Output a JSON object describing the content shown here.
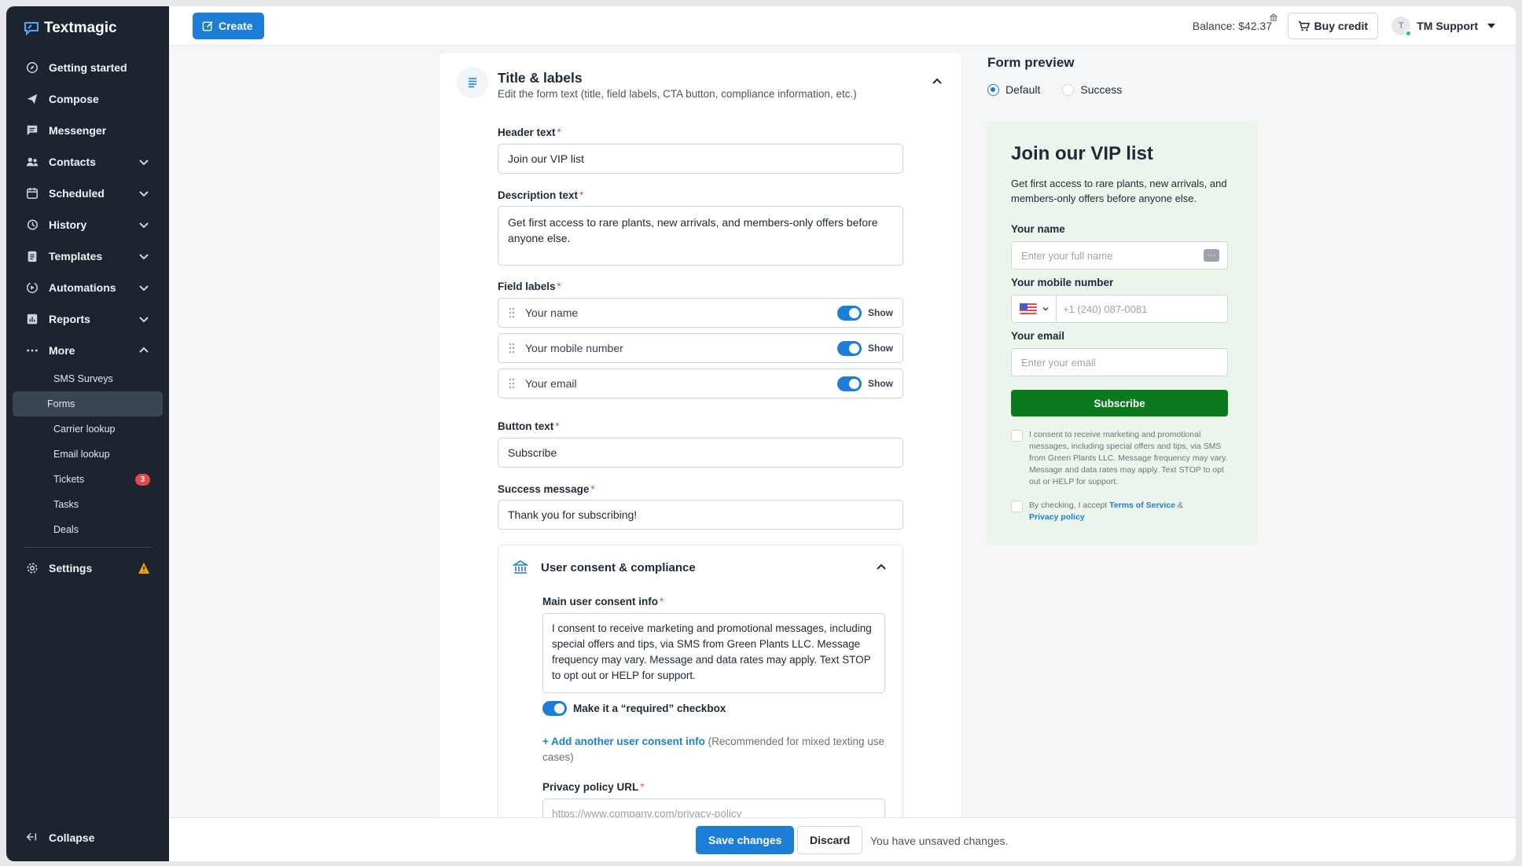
{
  "brand": {
    "name": "Textmagic"
  },
  "sidebar": {
    "items": [
      {
        "label": "Getting started",
        "icon": "compass-icon",
        "expandable": false
      },
      {
        "label": "Compose",
        "icon": "send-icon",
        "expandable": false
      },
      {
        "label": "Messenger",
        "icon": "chat-icon",
        "expandable": false
      },
      {
        "label": "Contacts",
        "icon": "contacts-icon",
        "expandable": true
      },
      {
        "label": "Scheduled",
        "icon": "calendar-icon",
        "expandable": true
      },
      {
        "label": "History",
        "icon": "history-icon",
        "expandable": true
      },
      {
        "label": "Templates",
        "icon": "clipboard-icon",
        "expandable": true
      },
      {
        "label": "Automations",
        "icon": "automation-icon",
        "expandable": true
      },
      {
        "label": "Reports",
        "icon": "chart-icon",
        "expandable": true
      },
      {
        "label": "More",
        "icon": "dots-icon",
        "expandable": true,
        "expanded": true
      }
    ],
    "more_sub": [
      {
        "label": "SMS Surveys"
      },
      {
        "label": "Forms",
        "active": true
      },
      {
        "label": "Carrier lookup"
      },
      {
        "label": "Email lookup"
      },
      {
        "label": "Tickets",
        "badge": "3"
      },
      {
        "label": "Tasks"
      },
      {
        "label": "Deals"
      }
    ],
    "settings_label": "Settings",
    "collapse_label": "Collapse"
  },
  "topbar": {
    "create_label": "Create",
    "balance": "Balance: $42.37",
    "buy_credit_label": "Buy credit",
    "user_initial": "T",
    "user_name": "TM Support"
  },
  "editor": {
    "section_title": "Title & labels",
    "section_desc": "Edit the form text (title, field labels, CTA button, compliance information, etc.)",
    "header_label": "Header text",
    "header_value": "Join our VIP list",
    "description_label": "Description text",
    "description_value": "Get first access to rare plants, new arrivals, and members-only offers before anyone else.",
    "field_labels_label": "Field labels",
    "field_labels": [
      {
        "text": "Your name",
        "show": "Show",
        "enabled": true
      },
      {
        "text": "Your mobile number",
        "show": "Show",
        "enabled": true
      },
      {
        "text": "Your email",
        "show": "Show",
        "enabled": true
      }
    ],
    "button_label": "Button text",
    "button_value": "Subscribe",
    "success_label": "Success message",
    "success_value": "Thank you for subscribing!",
    "consent": {
      "title": "User consent & compliance",
      "main_label": "Main user consent info",
      "main_value": "I consent to receive marketing and promotional messages, including special offers and tips, via SMS from Green Plants LLC. Message frequency may vary. Message and data rates may apply. Text STOP to opt out or HELP for support.",
      "required_label": "Make it a “required” checkbox",
      "add_link": "Add another user consent info",
      "add_note": "(Recommended for mixed texting use cases)",
      "privacy_label": "Privacy policy URL",
      "privacy_placeholder": "https://www.company.com/privacy-policy"
    }
  },
  "preview": {
    "title": "Form preview",
    "modes": [
      {
        "label": "Default",
        "selected": true
      },
      {
        "label": "Success",
        "selected": false
      }
    ],
    "heading": "Join our VIP list",
    "desc": "Get first access to rare plants, new arrivals, and members-only offers before anyone else.",
    "name_label": "Your name",
    "name_placeholder": "Enter your full name",
    "more_glyph": "···",
    "mobile_label": "Your mobile number",
    "mobile_placeholder": "+1 (240) 087-0081",
    "email_label": "Your email",
    "email_placeholder": "Enter your email",
    "button": "Subscribe",
    "consent_text": "I consent to receive marketing and promotional messages, including special offers and tips, via SMS from Green Plants LLC. Message frequency may vary. Message and data rates may apply. Text STOP to opt out or HELP for support.",
    "terms_prefix": "By checking, I accept",
    "terms_link": "Terms of Service",
    "terms_amp": "&",
    "privacy_link": "Privacy policy",
    "button_color": "#0b7a1e",
    "card_bg": "#ecf5ec"
  },
  "bottombar": {
    "save_label": "Save changes",
    "discard_label": "Discard",
    "unsaved_text": "You have unsaved changes."
  },
  "colors": {
    "accent": "#1c7ed6",
    "sidebar_bg": "#1c2430",
    "required": "#e5484d"
  }
}
